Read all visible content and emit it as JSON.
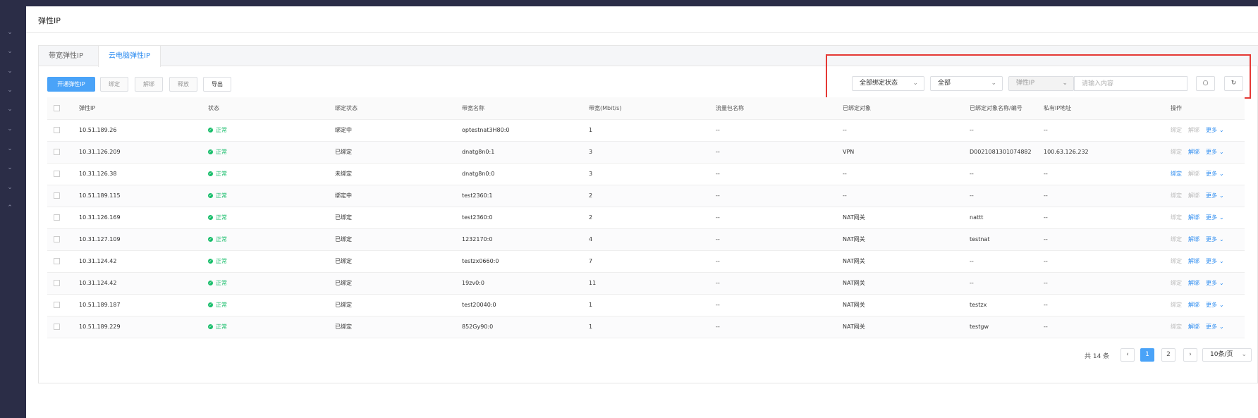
{
  "page": {
    "title": "弹性IP"
  },
  "tabs": [
    "带宽弹性IP",
    "云电脑弹性IP"
  ],
  "toolbar": {
    "open": "开通弹性IP",
    "bind": "绑定",
    "unbind": "解绑",
    "release": "释放",
    "export": "导出"
  },
  "filters": {
    "bind_status": "全部绑定状态",
    "scope": "全部",
    "field": "弹性IP",
    "search_placeholder": "请输入内容",
    "search_icon": "search-icon",
    "refresh_icon": "refresh-icon"
  },
  "table": {
    "headers": [
      "弹性IP",
      "状态",
      "绑定状态",
      "带宽名称",
      "带宽(Mbit/s)",
      "流量包名称",
      "已绑定对象",
      "已绑定对象名称/编号",
      "私有IP地址",
      "操作"
    ],
    "rows": [
      {
        "ip": "10.51.189.26",
        "status": "正常",
        "bind": "绑定中",
        "bw_name": "optestnat3H80:0",
        "bw": "1",
        "pkg": "--",
        "obj": "--",
        "obj_name": "--",
        "private_ip": "--",
        "ops": [
          "解绑_dis",
          "解绑_dis",
          "更多"
        ]
      },
      {
        "ip": "10.31.126.209",
        "status": "正常",
        "bind": "已绑定",
        "bw_name": "dnatg8n0:1",
        "bw": "3",
        "pkg": "--",
        "obj": "VPN",
        "obj_name": "D0021081301074882",
        "private_ip": "100.63.126.232"
      },
      {
        "ip": "10.31.126.38",
        "status": "正常",
        "bind": "未绑定",
        "bw_name": "dnatg8n0:0",
        "bw": "3",
        "pkg": "--",
        "obj": "--",
        "obj_name": "--",
        "private_ip": "--"
      },
      {
        "ip": "10.51.189.115",
        "status": "正常",
        "bind": "绑定中",
        "bw_name": "test2360:1",
        "bw": "2",
        "pkg": "--",
        "obj": "--",
        "obj_name": "--",
        "private_ip": "--"
      },
      {
        "ip": "10.31.126.169",
        "status": "正常",
        "bind": "已绑定",
        "bw_name": "test2360:0",
        "bw": "2",
        "pkg": "--",
        "obj": "NAT网关",
        "obj_name": "nattt",
        "private_ip": "--"
      },
      {
        "ip": "10.31.127.109",
        "status": "正常",
        "bind": "已绑定",
        "bw_name": "1232170:0",
        "bw": "4",
        "pkg": "--",
        "obj": "NAT网关",
        "obj_name": "testnat",
        "private_ip": "--"
      },
      {
        "ip": "10.31.124.42",
        "status": "正常",
        "bind": "已绑定",
        "bw_name": "testzx0660:0",
        "bw": "7",
        "pkg": "--",
        "obj": "NAT网关",
        "obj_name": "--",
        "private_ip": "--"
      },
      {
        "ip": "10.31.124.42",
        "status": "正常",
        "bind": "已绑定",
        "bw_name": "19zv0:0",
        "bw": "11",
        "pkg": "--",
        "obj": "NAT网关",
        "obj_name": "--",
        "private_ip": "--"
      },
      {
        "ip": "10.51.189.187",
        "status": "正常",
        "bind": "已绑定",
        "bw_name": "test20040:0",
        "bw": "1",
        "pkg": "--",
        "obj": "NAT网关",
        "obj_name": "testzx",
        "private_ip": "--"
      },
      {
        "ip": "10.51.189.229",
        "status": "正常",
        "bind": "已绑定",
        "bw_name": "852Gy90:0",
        "bw": "1",
        "pkg": "--",
        "obj": "NAT网关",
        "obj_name": "testgw",
        "private_ip": "--"
      }
    ],
    "ops_labels": {
      "bind": "绑定",
      "unbind": "解绑",
      "more": "更多"
    }
  },
  "pagination": {
    "total": "共 14 条",
    "pages": [
      "1",
      "2"
    ],
    "current": "1",
    "page_size": "10条/页"
  },
  "colors": {
    "accent": "#4aa3f8",
    "ok": "#19be6b",
    "highlight": "#e53935",
    "sidebar": "#2b2d47"
  }
}
